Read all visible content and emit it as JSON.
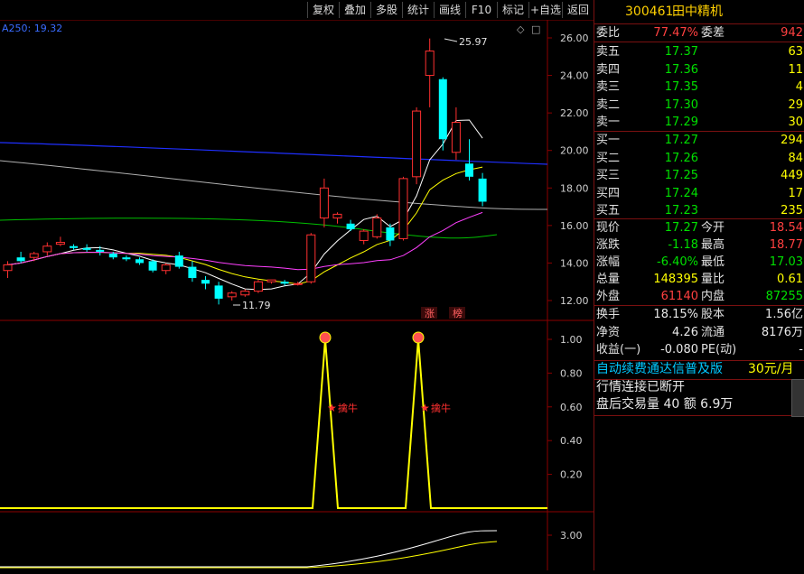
{
  "toolbar": {
    "buttons": [
      "复权",
      "叠加",
      "多股",
      "统计",
      "画线",
      "F10",
      "标记",
      "+自选",
      "返回"
    ]
  },
  "chart": {
    "ma_label": "A250: 19.32",
    "high_label": "25.97",
    "low_label": "11.79",
    "price_ticks": [
      "26.00",
      "24.00",
      "22.00",
      "20.00",
      "18.00",
      "16.00",
      "14.00",
      "12.00"
    ],
    "indicator_ticks": [
      "1.00",
      "0.80",
      "0.60",
      "0.40",
      "0.20"
    ],
    "bottom_tick": "3.00",
    "tag_zhang": "涨",
    "tag_bang": "榜",
    "signal_label": "擒牛",
    "colors": {
      "up": "#ff3030",
      "down": "#00ffff",
      "frame": "#8b0000",
      "signal": "#ffff00"
    }
  },
  "chart_data": {
    "type": "candlestick",
    "ylim": [
      11.5,
      26.5
    ],
    "candles": [
      {
        "o": 13.6,
        "h": 14.1,
        "l": 13.2,
        "c": 13.9
      },
      {
        "o": 14.3,
        "h": 14.6,
        "l": 14.0,
        "c": 14.1
      },
      {
        "o": 14.3,
        "h": 14.6,
        "l": 14.1,
        "c": 14.5
      },
      {
        "o": 14.6,
        "h": 15.1,
        "l": 14.4,
        "c": 14.9
      },
      {
        "o": 15.0,
        "h": 15.4,
        "l": 14.9,
        "c": 15.1
      },
      {
        "o": 14.9,
        "h": 15.0,
        "l": 14.7,
        "c": 14.8
      },
      {
        "o": 14.8,
        "h": 15.0,
        "l": 14.6,
        "c": 14.7
      },
      {
        "o": 14.7,
        "h": 14.9,
        "l": 14.4,
        "c": 14.6
      },
      {
        "o": 14.5,
        "h": 14.6,
        "l": 14.2,
        "c": 14.3
      },
      {
        "o": 14.3,
        "h": 14.4,
        "l": 14.1,
        "c": 14.2
      },
      {
        "o": 14.2,
        "h": 14.3,
        "l": 13.9,
        "c": 14.0
      },
      {
        "o": 14.1,
        "h": 14.2,
        "l": 13.5,
        "c": 13.6
      },
      {
        "o": 13.6,
        "h": 14.0,
        "l": 13.4,
        "c": 13.9
      },
      {
        "o": 14.4,
        "h": 14.6,
        "l": 13.7,
        "c": 13.8
      },
      {
        "o": 13.8,
        "h": 14.1,
        "l": 13.0,
        "c": 13.2
      },
      {
        "o": 13.1,
        "h": 13.3,
        "l": 12.6,
        "c": 12.9
      },
      {
        "o": 12.8,
        "h": 13.0,
        "l": 11.79,
        "c": 12.1
      },
      {
        "o": 12.2,
        "h": 12.5,
        "l": 12.0,
        "c": 12.4
      },
      {
        "o": 12.3,
        "h": 12.6,
        "l": 12.2,
        "c": 12.5
      },
      {
        "o": 12.5,
        "h": 13.1,
        "l": 12.4,
        "c": 13.0
      },
      {
        "o": 13.0,
        "h": 13.1,
        "l": 12.9,
        "c": 13.1
      },
      {
        "o": 13.0,
        "h": 13.1,
        "l": 12.8,
        "c": 12.9
      },
      {
        "o": 12.9,
        "h": 13.0,
        "l": 12.8,
        "c": 12.9
      },
      {
        "o": 13.0,
        "h": 15.6,
        "l": 12.9,
        "c": 15.5
      },
      {
        "o": 16.4,
        "h": 18.5,
        "l": 15.9,
        "c": 18.0
      },
      {
        "o": 16.4,
        "h": 16.7,
        "l": 16.1,
        "c": 16.6
      },
      {
        "o": 16.1,
        "h": 16.3,
        "l": 15.7,
        "c": 15.8
      },
      {
        "o": 15.2,
        "h": 15.8,
        "l": 15.0,
        "c": 15.7
      },
      {
        "o": 15.4,
        "h": 16.6,
        "l": 15.3,
        "c": 16.4
      },
      {
        "o": 15.9,
        "h": 16.1,
        "l": 14.9,
        "c": 15.2
      },
      {
        "o": 15.3,
        "h": 18.6,
        "l": 15.2,
        "c": 18.5
      },
      {
        "o": 18.6,
        "h": 22.3,
        "l": 18.2,
        "c": 22.1
      },
      {
        "o": 24.0,
        "h": 25.97,
        "l": 22.3,
        "c": 25.3
      },
      {
        "o": 23.8,
        "h": 23.9,
        "l": 20.0,
        "c": 20.6
      },
      {
        "o": 19.9,
        "h": 22.3,
        "l": 19.5,
        "c": 21.5
      },
      {
        "o": 19.3,
        "h": 20.6,
        "l": 18.4,
        "c": 18.6
      },
      {
        "o": 18.5,
        "h": 18.8,
        "l": 17.03,
        "c": 17.27
      }
    ],
    "indicator_signals": [
      0.0,
      1.0,
      0.0,
      1.0,
      0.0
    ],
    "indicator_ylim": [
      0,
      1.0
    ]
  },
  "stock": {
    "code": "300461",
    "name": "田中精机"
  },
  "quote": {
    "weibi_label": "委比",
    "weibi": "77.47%",
    "weicha_label": "委差",
    "weicha": "942",
    "asks": [
      {
        "label": "卖五",
        "price": "17.37",
        "vol": "63"
      },
      {
        "label": "卖四",
        "price": "17.36",
        "vol": "11"
      },
      {
        "label": "卖三",
        "price": "17.35",
        "vol": "4"
      },
      {
        "label": "卖二",
        "price": "17.30",
        "vol": "29"
      },
      {
        "label": "卖一",
        "price": "17.29",
        "vol": "30"
      }
    ],
    "bids": [
      {
        "label": "买一",
        "price": "17.27",
        "vol": "294"
      },
      {
        "label": "买二",
        "price": "17.26",
        "vol": "84"
      },
      {
        "label": "买三",
        "price": "17.25",
        "vol": "449"
      },
      {
        "label": "买四",
        "price": "17.24",
        "vol": "17"
      },
      {
        "label": "买五",
        "price": "17.23",
        "vol": "235"
      }
    ],
    "stats": [
      {
        "l1": "现价",
        "v1": "17.27",
        "l2": "今开",
        "v2": "18.54",
        "c1": "green",
        "c2": "red"
      },
      {
        "l1": "涨跌",
        "v1": "-1.18",
        "l2": "最高",
        "v2": "18.77",
        "c1": "green",
        "c2": "red"
      },
      {
        "l1": "涨幅",
        "v1": "-6.40%",
        "l2": "最低",
        "v2": "17.03",
        "c1": "green",
        "c2": "green"
      },
      {
        "l1": "总量",
        "v1": "148395",
        "l2": "量比",
        "v2": "0.61",
        "c1": "yellow",
        "c2": "yellow"
      },
      {
        "l1": "外盘",
        "v1": "61140",
        "l2": "内盘",
        "v2": "87255",
        "c1": "red",
        "c2": "green"
      }
    ],
    "info": [
      {
        "l1": "换手",
        "v1": "18.15%",
        "l2": "股本",
        "v2": "1.56亿"
      },
      {
        "l1": "净资",
        "v1": "4.26",
        "l2": "流通",
        "v2": "8176万"
      },
      {
        "l1": "收益(一)",
        "v1": "-0.080",
        "l2": "PE(动)",
        "v2": "-"
      }
    ],
    "promo": "自动续费通达信普及版",
    "promo_price": "30元/月",
    "status1": "行情连接已断开",
    "status2": "盘后交易量 40 额 6.9万"
  }
}
